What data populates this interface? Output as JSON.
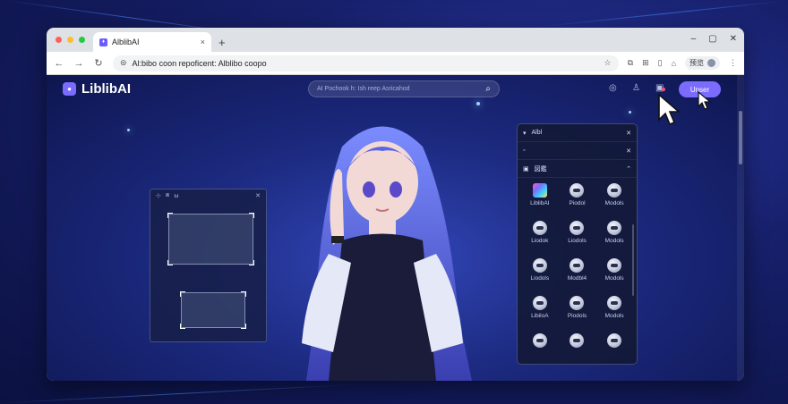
{
  "browser": {
    "tab_title": "AlblibAI",
    "tab_close": "×",
    "new_tab": "+",
    "address": "Al:bibo coon repoficent: Alblibo coopo",
    "profile_label": "预览"
  },
  "site": {
    "logo_text": "LiblibAI",
    "search_placeholder": "AI Pochook h: Ish reep Asricahod",
    "user_button": "Unser"
  },
  "edit_panel": {
    "header_label": "ы"
  },
  "model_panel": {
    "title": "Albl",
    "section_label": "図鑑",
    "items": [
      {
        "label": "LiblibAI",
        "icon": "gradient-icon"
      },
      {
        "label": "Piodol",
        "icon": "robot-icon"
      },
      {
        "label": "Modols",
        "icon": "robot-icon"
      },
      {
        "label": "Liodok",
        "icon": "robot-icon"
      },
      {
        "label": "Liodols",
        "icon": "robot-icon"
      },
      {
        "label": "Modols",
        "icon": "robot-icon"
      },
      {
        "label": "Liodols",
        "icon": "robot-icon"
      },
      {
        "label": "Modbl4",
        "icon": "robot-icon"
      },
      {
        "label": "Modols",
        "icon": "robot-icon"
      },
      {
        "label": "LibiloA",
        "icon": "robot-icon"
      },
      {
        "label": "Piodols",
        "icon": "robot-icon"
      },
      {
        "label": "Modols",
        "icon": "robot-icon"
      },
      {
        "label": "",
        "icon": "robot-icon"
      },
      {
        "label": "",
        "icon": "robot-icon"
      },
      {
        "label": "",
        "icon": "robot-icon"
      }
    ]
  },
  "colors": {
    "accent": "#7b6cff",
    "background": "#17206b"
  }
}
